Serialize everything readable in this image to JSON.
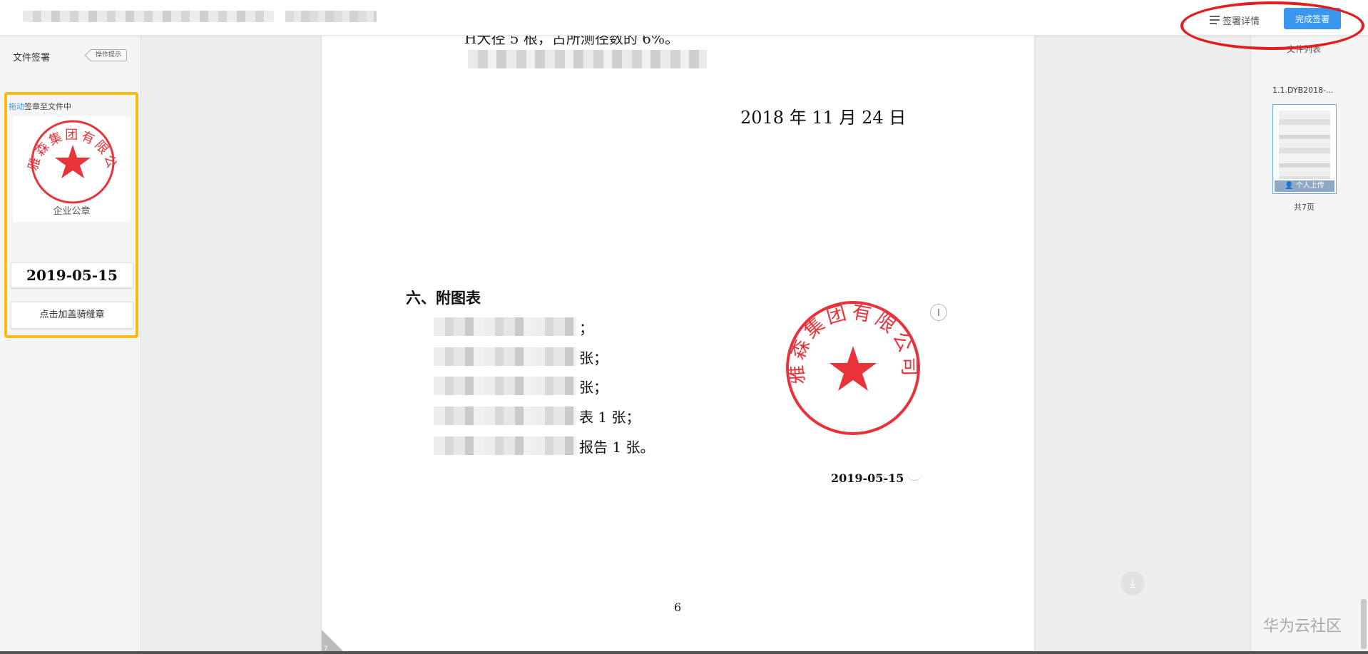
{
  "topbar": {
    "sign_detail_label": "签署详情",
    "finish_button_label": "完成签署",
    "highlight_color": "#e31e1e"
  },
  "left_panel": {
    "title": "文件签署",
    "op_hint_label": "操作提示",
    "drag_hint_link": "拖动",
    "drag_hint_rest": "签章至文件中",
    "seal_caption": "企业公章",
    "date_stamp": "2019-05-15",
    "seam_seal_button": "点击加盖骑缝章",
    "highlight_color": "#fcba12"
  },
  "document": {
    "cutoff_line": "H大径 5 根，占所测径数的 6%。",
    "sign_date": "2018 年 11 月 24 日",
    "section_title": "六、附图表",
    "list_suffixes": [
      "；",
      "张；",
      "张；",
      "表 1 张；",
      "报告 1 张。"
    ],
    "stamp_date": "2019-05-15",
    "page_number": "6",
    "corner_number": "7"
  },
  "right_panel": {
    "title": "文件列表",
    "file_name": "1.1.DYB2018-...",
    "thumb_label": "个人上传",
    "page_count": "共7页"
  },
  "icons": {
    "list": "list-icon",
    "download": "download-icon",
    "rotate": "rotate-handle-icon",
    "user": "user-icon"
  },
  "seal_color": "#e8333a",
  "accent_color": "#3a97f0",
  "watermark": "华为云社区"
}
